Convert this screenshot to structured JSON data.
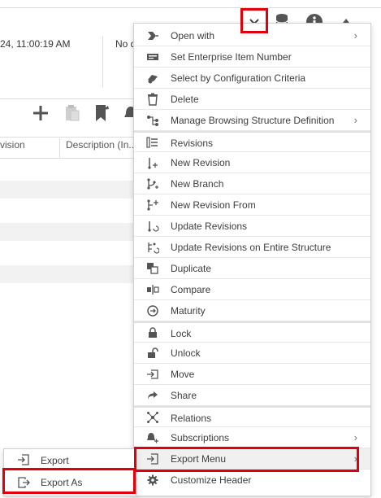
{
  "background": {
    "datetime_partial": "24, 11:00:19 AM",
    "second_field_partial": "No d",
    "columns": [
      {
        "label": "vision"
      },
      {
        "label": "Description (In..."
      }
    ]
  },
  "top_icons": [
    "chevron-down-icon",
    "database-icon",
    "info-icon",
    "triangle-up-icon"
  ],
  "context_menu": {
    "items": [
      {
        "label": "Open with",
        "icon": "open-with-icon",
        "submenu": true
      },
      {
        "label": "Set Enterprise Item Number",
        "icon": "card-icon",
        "submenu": false
      },
      {
        "label": "Select by Configuration Criteria",
        "icon": "config-criteria-icon",
        "submenu": false
      },
      {
        "label": "Delete",
        "icon": "trash-icon",
        "submenu": false
      },
      {
        "label": "Manage Browsing Structure Definition",
        "icon": "structure-icon",
        "submenu": true
      },
      {
        "label": "Revisions",
        "icon": "revisions-icon",
        "submenu": false
      },
      {
        "label": "New Revision",
        "icon": "new-revision-icon",
        "submenu": false
      },
      {
        "label": "New Branch",
        "icon": "branch-icon",
        "submenu": false
      },
      {
        "label": "New Revision From",
        "icon": "revision-from-icon",
        "submenu": false
      },
      {
        "label": "Update Revisions",
        "icon": "update-revisions-icon",
        "submenu": false
      },
      {
        "label": "Update Revisions on Entire Structure",
        "icon": "update-structure-icon",
        "submenu": false
      },
      {
        "label": "Duplicate",
        "icon": "duplicate-icon",
        "submenu": false
      },
      {
        "label": "Compare",
        "icon": "compare-icon",
        "submenu": false
      },
      {
        "label": "Maturity",
        "icon": "maturity-icon",
        "submenu": false
      },
      {
        "label": "Lock",
        "icon": "lock-icon",
        "submenu": false
      },
      {
        "label": "Unlock",
        "icon": "unlock-icon",
        "submenu": false
      },
      {
        "label": "Move",
        "icon": "move-icon",
        "submenu": false
      },
      {
        "label": "Share",
        "icon": "share-icon",
        "submenu": false
      },
      {
        "label": "Relations",
        "icon": "relations-icon",
        "submenu": false
      },
      {
        "label": "Subscriptions",
        "icon": "subscriptions-icon",
        "submenu": true
      },
      {
        "label": "Export Menu",
        "icon": "export-icon",
        "submenu": true
      },
      {
        "label": "Customize Header",
        "icon": "gear-icon",
        "submenu": false
      }
    ]
  },
  "export_submenu": {
    "items": [
      {
        "label": "Export",
        "icon": "export-icon"
      },
      {
        "label": "Export As",
        "icon": "export-as-icon"
      }
    ]
  },
  "colors": {
    "highlight_box": "#e0000b",
    "menu_hover": "#f0f0f0"
  }
}
